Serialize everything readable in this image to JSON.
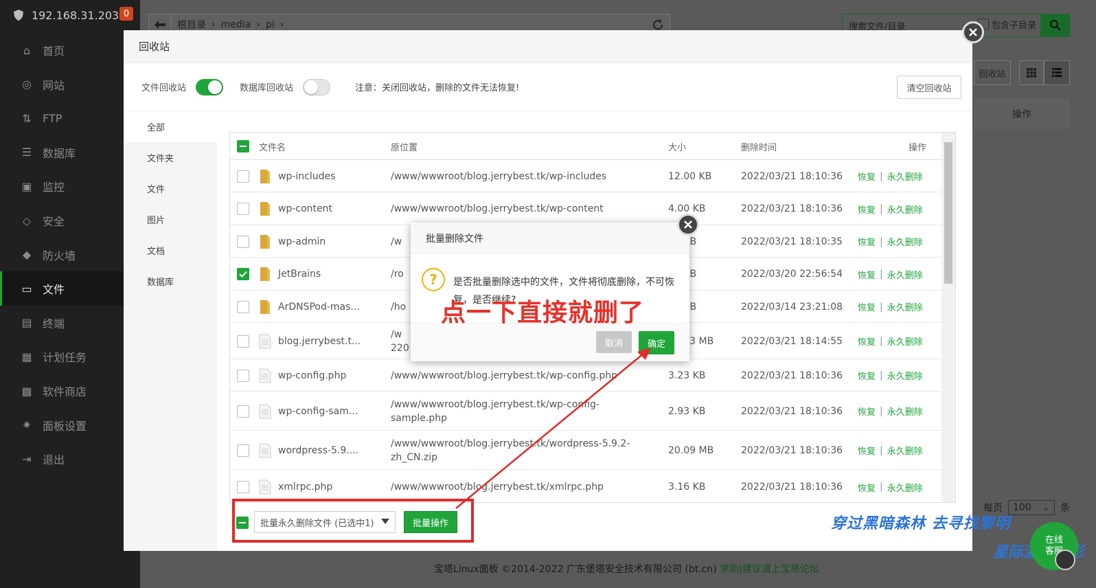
{
  "sidebar": {
    "host": "192.168.31.203",
    "badge": "0",
    "items": [
      {
        "label": "首页",
        "icon": "home-icon"
      },
      {
        "label": "网站",
        "icon": "globe-icon"
      },
      {
        "label": "FTP",
        "icon": "ftp-icon"
      },
      {
        "label": "数据库",
        "icon": "database-icon"
      },
      {
        "label": "监控",
        "icon": "monitor-icon"
      },
      {
        "label": "安全",
        "icon": "shield-icon"
      },
      {
        "label": "防火墙",
        "icon": "firewall-icon"
      },
      {
        "label": "文件",
        "icon": "folder-icon",
        "active": true
      },
      {
        "label": "终端",
        "icon": "terminal-icon"
      },
      {
        "label": "计划任务",
        "icon": "calendar-icon"
      },
      {
        "label": "软件商店",
        "icon": "apps-icon"
      },
      {
        "label": "面板设置",
        "icon": "gear-icon"
      },
      {
        "label": "退出",
        "icon": "logout-icon"
      }
    ]
  },
  "background": {
    "breadcrumb": [
      "根目录",
      "media",
      "pi"
    ],
    "search_placeholder": "搜索文件/目录",
    "include_subdir": "包含子目录",
    "recycle_button": "回收站",
    "op_header": "操作",
    "footer_text": "宝塔Linux面板 ©2014-2022 广东堡塔安全技术有限公司 (bt.cn)",
    "footer_link": "求助|建议请上宝塔论坛",
    "per_page_label": "每页",
    "per_page_value": "100",
    "per_page_unit": "条"
  },
  "recycle": {
    "title": "回收站",
    "file_recycle_label": "文件回收站",
    "db_recycle_label": "数据库回收站",
    "notice": "注意：关闭回收站，删除的文件无法恢复!",
    "clear_button": "清空回收站",
    "categories": [
      "全部",
      "文件夹",
      "文件",
      "图片",
      "文档",
      "数据库"
    ],
    "columns": {
      "name": "文件名",
      "location": "原位置",
      "size": "大小",
      "time": "删除时间",
      "ops": "操作"
    },
    "restore_label": "恢复",
    "delete_label": "永久删除",
    "rows": [
      {
        "name": "wp-includes",
        "type": "folder",
        "location": "/www/wwwroot/blog.jerrybest.tk/wp-includes",
        "location2": "",
        "size": "12.00 KB",
        "time": "2022/03/21 18:10:36",
        "checked": false
      },
      {
        "name": "wp-content",
        "type": "folder",
        "location": "/www/wwwroot/blog.jerrybest.tk/wp-content",
        "location2": "",
        "size": "4.00 KB",
        "time": "2022/03/21 18:10:36",
        "checked": false
      },
      {
        "name": "wp-admin",
        "type": "folder",
        "location": "/w",
        "location2": "",
        "size": "00 KB",
        "time": "2022/03/21 18:10:35",
        "checked": false
      },
      {
        "name": "JetBrains",
        "type": "folder",
        "location": "/ro",
        "location2": "",
        "size": "00 KB",
        "time": "2022/03/20 22:56:54",
        "checked": true
      },
      {
        "name": "ArDNSPod-mas...",
        "type": "folder",
        "location": "/ho",
        "location2": "",
        "size": "00 KB",
        "time": "2022/03/14 23:21:08",
        "checked": false
      },
      {
        "name": "blog.jerrybest.t...",
        "type": "file",
        "location": "/w",
        "location2": "220",
        "size": "36.13 MB",
        "time": "2022/03/21 18:14:55",
        "checked": false
      },
      {
        "name": "wp-config.php",
        "type": "file",
        "location": "/www/wwwroot/blog.jerrybest.tk/wp-config.php",
        "location2": "",
        "size": "3.23 KB",
        "time": "2022/03/21 18:10:36",
        "checked": false
      },
      {
        "name": "wp-config-sam...",
        "type": "file",
        "location": "/www/wwwroot/blog.jerrybest.tk/wp-config-",
        "location2": "sample.php",
        "size": "2.93 KB",
        "time": "2022/03/21 18:10:36",
        "checked": false
      },
      {
        "name": "wordpress-5.9....",
        "type": "file",
        "location": "/www/wwwroot/blog.jerrybest.tk/wordpress-5.9.2-",
        "location2": "zh_CN.zip",
        "size": "20.09 MB",
        "time": "2022/03/21 18:10:36",
        "checked": false
      },
      {
        "name": "xmlrpc.php",
        "type": "file",
        "location": "/www/wwwroot/blog.jerrybest.tk/xmlrpc.php",
        "location2": "",
        "size": "3.16 KB",
        "time": "2022/03/21 18:10:36",
        "checked": false
      }
    ],
    "batch_select": "批量永久删除文件 (已选中1)",
    "batch_button": "批量操作"
  },
  "dialog": {
    "title": "批量删除文件",
    "message": "是否批量删除选中的文件，文件将彻底删除，不可恢复，是否继续?",
    "cancel": "取消",
    "confirm": "确定"
  },
  "annotation": "点一下直接就删了",
  "watermark": {
    "line1": "穿过黑暗森林 去寻找黎明",
    "line2": "星际酒下遗彩"
  },
  "online_service": "在线\n客服",
  "colors": {
    "accent": "#20a53a",
    "annotation": "#e02b2b"
  }
}
